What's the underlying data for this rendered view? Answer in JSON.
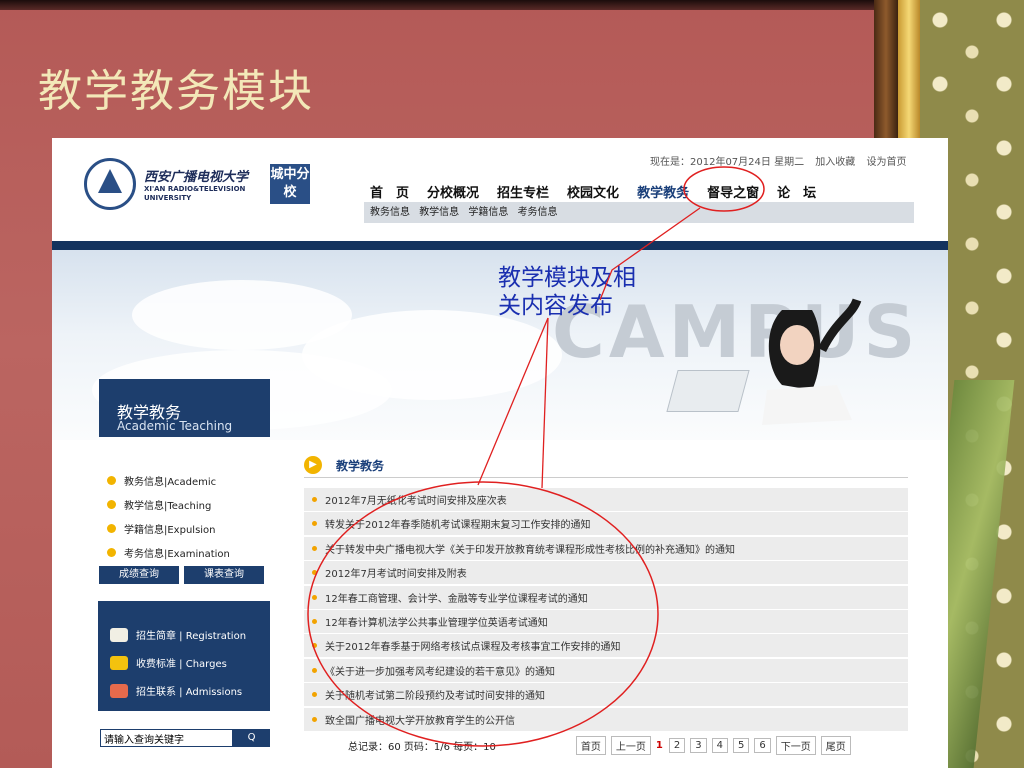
{
  "slide": {
    "title": "教学教务模块",
    "annotation_line1": "教学模块及相",
    "annotation_line2": "关内容发布"
  },
  "header": {
    "university_cn": "西安广播电视大学",
    "university_en": "XI'AN RADIO&TELEVISION UNIVERSITY",
    "branch": "城中分校",
    "date_text": "现在是：2012年07月24日 星期二",
    "add_favorite": "加入收藏",
    "set_home": "设为首页"
  },
  "nav": {
    "items": [
      "首　页",
      "分校概况",
      "招生专栏",
      "校园文化",
      "教学教务",
      "督导之窗",
      "论　坛"
    ],
    "active": "教学教务",
    "sub": [
      "教务信息",
      "教学信息",
      "学籍信息",
      "考务信息"
    ]
  },
  "banner": {
    "section_cn": "教学教务",
    "section_en": "Academic Teaching",
    "campus_word": "CAMPUS"
  },
  "sidebar": {
    "items": [
      "教务信息|Academic",
      "教学信息|Teaching",
      "学籍信息|Expulsion",
      "考务信息|Examination"
    ],
    "query_buttons": [
      "成绩查询",
      "课表查询"
    ],
    "enroll": [
      "招生简章 | Registration",
      "收费标准 | Charges",
      "招生联系 | Admissions"
    ],
    "search_placeholder": "请输入查询关键字",
    "search_button": "Q"
  },
  "main": {
    "heading": "教学教务",
    "rows": [
      "2012年7月无纸化考试时间安排及座次表",
      "转发关于2012年春季随机考试课程期末复习工作安排的通知",
      "关于转发中央广播电视大学《关于印发开放教育统考课程形成性考核比例的补充通知》的通知",
      "2012年7月考试时间安排及附表",
      "12年春工商管理、会计学、金融等专业学位课程考试的通知",
      "12年春计算机法学公共事业管理学位英语考试通知",
      "关于2012年春季基于网络考核试点课程及考核事宜工作安排的通知",
      "《关于进一步加强考风考纪建设的若干意见》的通知",
      "关于随机考试第二阶段预约及考试时间安排的通知",
      "致全国广播电视大学开放教育学生的公开信"
    ]
  },
  "pager": {
    "summary": "总记录：60 页码：1/6 每页：10",
    "first": "首页",
    "prev": "上一页",
    "current": "1",
    "pages": [
      "2",
      "3",
      "4",
      "5",
      "6"
    ],
    "next": "下一页",
    "last": "尾页"
  },
  "colors": {
    "slide_bg": "#b85f5b",
    "title": "#f3e8b8",
    "navy": "#1d3e6d",
    "annotation": "#1a2fb0",
    "ellipse": "#e02020"
  }
}
